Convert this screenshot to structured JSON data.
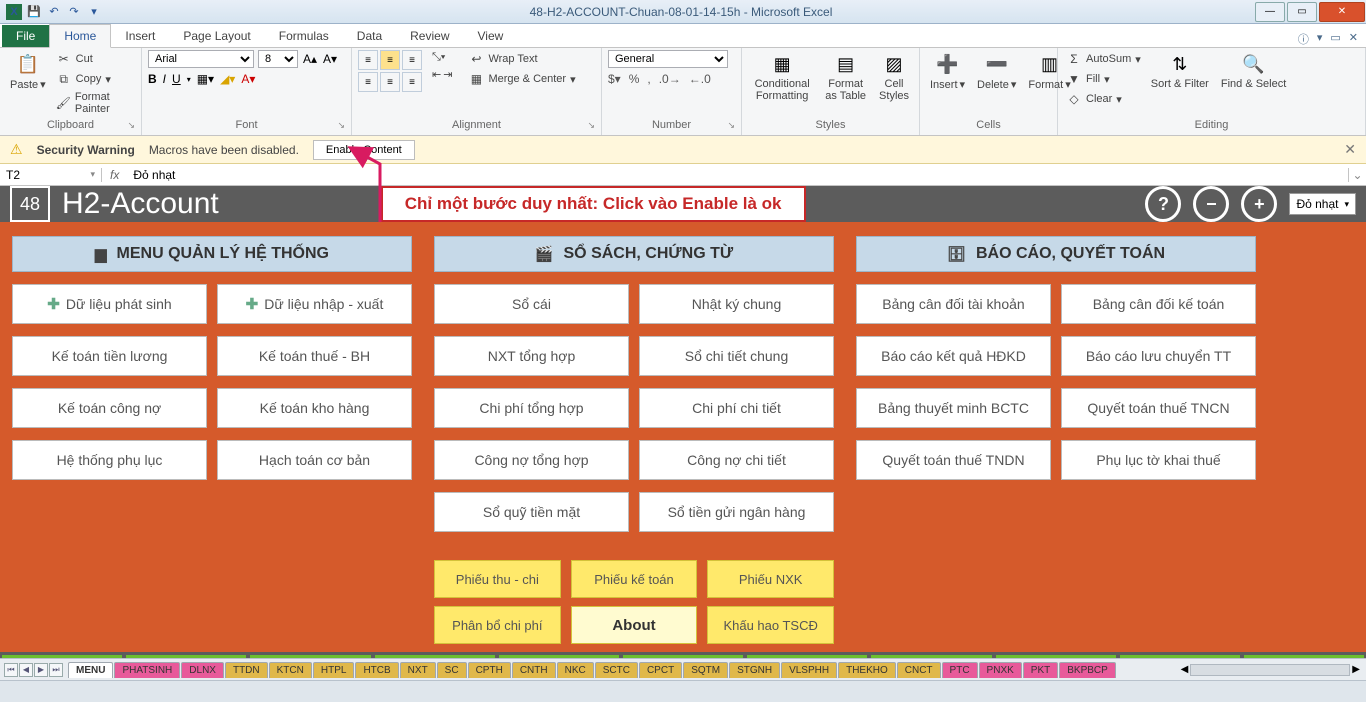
{
  "titlebar": {
    "title": "48-H2-ACCOUNT-Chuan-08-01-14-15h - Microsoft Excel"
  },
  "ribbon": {
    "file": "File",
    "tabs": [
      "Home",
      "Insert",
      "Page Layout",
      "Formulas",
      "Data",
      "Review",
      "View"
    ],
    "clipboard": {
      "paste": "Paste",
      "cut": "Cut",
      "copy": "Copy",
      "fmt": "Format Painter",
      "label": "Clipboard"
    },
    "font": {
      "name": "Arial",
      "size": "8",
      "label": "Font"
    },
    "alignment": {
      "wrap": "Wrap Text",
      "merge": "Merge & Center",
      "label": "Alignment"
    },
    "number": {
      "fmt": "General",
      "label": "Number"
    },
    "styles": {
      "cond": "Conditional Formatting",
      "table": "Format as Table",
      "cell": "Cell Styles",
      "label": "Styles"
    },
    "cells": {
      "insert": "Insert",
      "delete": "Delete",
      "format": "Format",
      "label": "Cells"
    },
    "editing": {
      "sum": "AutoSum",
      "fill": "Fill",
      "clear": "Clear",
      "sort": "Sort & Filter",
      "find": "Find & Select",
      "label": "Editing"
    }
  },
  "sec": {
    "title": "Security Warning",
    "msg": "Macros have been disabled.",
    "btn": "Enable Content"
  },
  "fbar": {
    "cell": "T2",
    "fx": "fx",
    "formula": "Đỏ nhạt"
  },
  "app": {
    "badge": "48",
    "title": "H2-Account",
    "callout": "Chỉ một bước duy nhất: Click vào Enable là ok",
    "select": "Đỏ nhạt"
  },
  "col1": {
    "head": "MENU QUẢN LÝ HỆ THỐNG",
    "rows": [
      [
        "Dữ liệu phát sinh",
        "Dữ liệu nhập - xuất"
      ],
      [
        "Kế toán tiền lương",
        "Kế toán thuế - BH"
      ],
      [
        "Kế toán công nợ",
        "Kế toán kho hàng"
      ],
      [
        "Hệ thống phụ lục",
        "Hạch toán cơ bản"
      ]
    ]
  },
  "col2": {
    "head": "SỔ SÁCH, CHỨNG TỪ",
    "rows": [
      [
        "Sổ cái",
        "Nhật ký chung"
      ],
      [
        "NXT tổng hợp",
        "Sổ chi tiết chung"
      ],
      [
        "Chi phí tổng hợp",
        "Chi phí chi tiết"
      ],
      [
        "Công nợ tổng hợp",
        "Công nợ chi tiết"
      ],
      [
        "Sổ quỹ tiền mặt",
        "Sổ tiền gửi ngân hàng"
      ]
    ],
    "yrows": [
      [
        "Phiếu thu - chi",
        "Phiếu kế toán",
        "Phiếu NXK"
      ],
      [
        "Phân bổ chi phí",
        "About",
        "Khấu hao TSCĐ"
      ]
    ]
  },
  "col3": {
    "head": "BÁO CÁO, QUYẾT TOÁN",
    "rows": [
      [
        "Bảng cân đối tài khoản",
        "Bảng cân đối kế toán"
      ],
      [
        "Báo cáo kết quả HĐKD",
        "Báo cáo lưu chuyển  TT"
      ],
      [
        "Bảng thuyết minh BCTC",
        "Quyết toán thuế TNCN"
      ],
      [
        "Quyết toán thuế TNDN",
        "Phụ lục tờ khai thuế"
      ]
    ]
  },
  "ws": [
    "MENU",
    "PHATSINH",
    "DLNX",
    "TTDN",
    "KTCN",
    "HTPL",
    "HTCB",
    "NXT",
    "SC",
    "CPTH",
    "CNTH",
    "NKC",
    "SCTC",
    "CPCT",
    "SQTM",
    "STGNH",
    "VLSPHH",
    "THEKHO",
    "CNCT",
    "PTC",
    "PNXK",
    "PKT",
    "BKPBCP"
  ]
}
